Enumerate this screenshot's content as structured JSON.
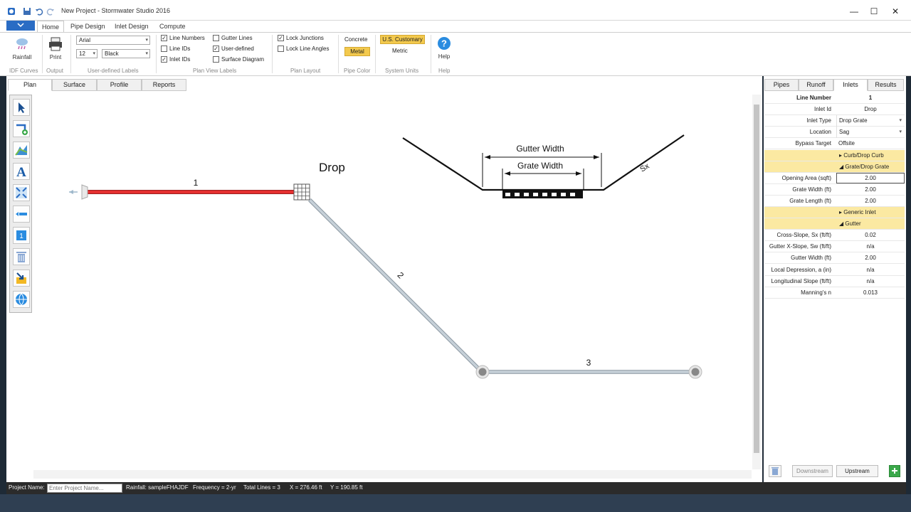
{
  "window": {
    "title": "New Project - Stormwater Studio 2016",
    "minimize": "—",
    "maximize": "☐",
    "close": "✕"
  },
  "ribbon_tabs": [
    "Home",
    "Pipe Design",
    "Inlet Design",
    "Compute"
  ],
  "ribbon": {
    "rainfall_label": "Rainfall",
    "idf_curves_group": "IDF Curves",
    "print_label": "Print",
    "output_group": "Output",
    "font_name": "Arial",
    "font_size": "12",
    "font_color": "Black",
    "user_labels_group": "User-defined Labels",
    "line_numbers": "Line Numbers",
    "line_ids": "Line IDs",
    "inlet_ids": "Inlet IDs",
    "gutter_lines": "Gutter Lines",
    "user_defined": "User-defined",
    "surface_diagram": "Surface Diagram",
    "plan_view_labels_group": "Plan View Labels",
    "lock_junctions": "Lock Junctions",
    "lock_line_angles": "Lock Line Angles",
    "plan_layout_group": "Plan Layout",
    "concrete": "Concrete",
    "metal": "Metal",
    "pipe_color_group": "Pipe Color",
    "us_customary": "U.S. Customary",
    "metric": "Metric",
    "system_units_group": "System Units",
    "help_label": "Help",
    "help_group": "Help"
  },
  "view_tabs": [
    "Plan",
    "Surface",
    "Profile",
    "Reports"
  ],
  "canvas": {
    "line1_label": "1",
    "line2_label": "2",
    "line3_label": "3",
    "inlet_label": "Drop",
    "gutter_width_label": "Gutter Width",
    "grate_width_label": "Grate Width",
    "sx_label": "Sx"
  },
  "panel_tabs": [
    "Pipes",
    "Runoff",
    "Inlets",
    "Results"
  ],
  "properties": [
    {
      "label": "Line Number",
      "value": "1",
      "type": "header"
    },
    {
      "label": "Inlet Id",
      "value": "Drop",
      "type": "center"
    },
    {
      "label": "Inlet Type",
      "value": "Drop Grate",
      "type": "dropdown"
    },
    {
      "label": "Location",
      "value": "Sag",
      "type": "dropdown"
    },
    {
      "label": "Bypass Target",
      "value": "Offsite",
      "type": "left"
    },
    {
      "label": "",
      "value": "▸ Curb/Drop Curb",
      "type": "section"
    },
    {
      "label": "",
      "value": "◢ Grate/Drop Grate",
      "type": "section"
    },
    {
      "label": "Opening Area (sqft)",
      "value": "2.00",
      "type": "edit"
    },
    {
      "label": "Grate Width (ft)",
      "value": "2.00",
      "type": "center"
    },
    {
      "label": "Grate Length (ft)",
      "value": "2.00",
      "type": "center"
    },
    {
      "label": "",
      "value": "▸ Generic Inlet",
      "type": "section"
    },
    {
      "label": "",
      "value": "◢ Gutter",
      "type": "section"
    },
    {
      "label": "Cross-Slope, Sx (ft/ft)",
      "value": "0.02",
      "type": "center"
    },
    {
      "label": "Gutter X-Slope, Sw (ft/ft)",
      "value": "n/a",
      "type": "center"
    },
    {
      "label": "Gutter Width (ft)",
      "value": "2.00",
      "type": "center"
    },
    {
      "label": "Local Depression, a (in)",
      "value": "n/a",
      "type": "center"
    },
    {
      "label": "Longitudinal Slope (ft/ft)",
      "value": "n/a",
      "type": "center"
    },
    {
      "label": "Manning's n",
      "value": "0.013",
      "type": "center"
    }
  ],
  "panel_buttons": {
    "downstream": "Downstream",
    "upstream": "Upstream"
  },
  "status": {
    "project_name_label": "Project Name:",
    "project_name_placeholder": "Enter Project Name...",
    "rainfall": "Rainfall: sampleFHAJDF",
    "frequency": "Frequency = 2-yr",
    "total_lines": "Total Lines = 3",
    "x_coord": "X = 276.46 ft",
    "y_coord": "Y = 190.85 ft"
  },
  "colors": {
    "accent": "#2a6cc4",
    "selected_pipe": "#e53030",
    "pipe": "#b9c3cc",
    "highlight": "#f3c94d",
    "section": "#fbe9a2"
  }
}
